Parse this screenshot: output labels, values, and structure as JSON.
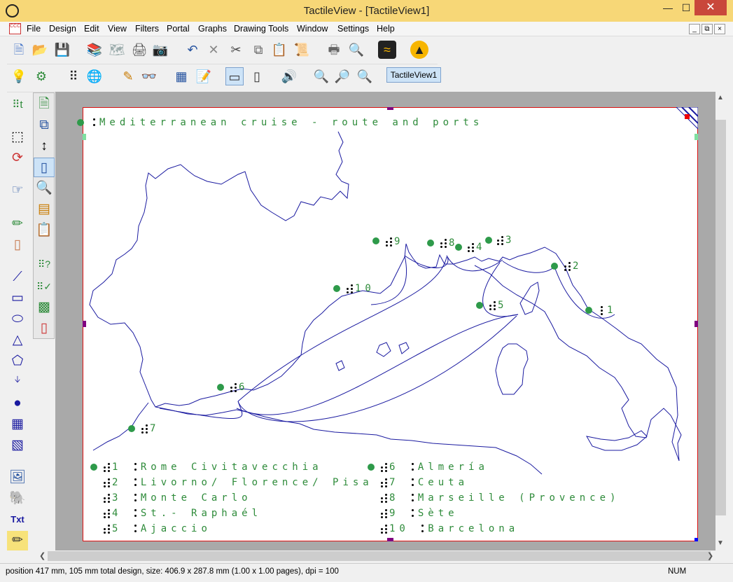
{
  "window": {
    "title": "TactileView - [TactileView1]"
  },
  "menu": {
    "items": [
      "File",
      "Design",
      "Edit",
      "View",
      "Filters",
      "Portal",
      "Graphs",
      "Drawing Tools",
      "Window",
      "Settings",
      "Help"
    ]
  },
  "toolbar": {
    "tab_label": "TactileView1"
  },
  "map": {
    "title": "Mediterranean cruise - route and ports",
    "ports": [
      {
        "num": "1",
        "name": "Rome  Civitavecchia"
      },
      {
        "num": "2",
        "name": "Livorno/ Florence/ Pisa"
      },
      {
        "num": "3",
        "name": "Monte  Carlo"
      },
      {
        "num": "4",
        "name": "St.- Raphaél"
      },
      {
        "num": "5",
        "name": "Ajaccio"
      },
      {
        "num": "6",
        "name": "Almería"
      },
      {
        "num": "7",
        "name": "Ceuta"
      },
      {
        "num": "8",
        "name": "Marseille (Provence)"
      },
      {
        "num": "9",
        "name": "Sète"
      },
      {
        "num": "10",
        "name": "Barcelona"
      }
    ]
  },
  "status": {
    "text": "position 417 mm, 105 mm total design, size: 406.9 x 287.8 mm (1.00 x 1.00 pages), dpi = 100",
    "mode": "NUM"
  },
  "colors": {
    "accent": "#2e8b3a",
    "title_bar": "#f7d777",
    "route": "#1a1aa0",
    "page_border": "#d11111"
  }
}
